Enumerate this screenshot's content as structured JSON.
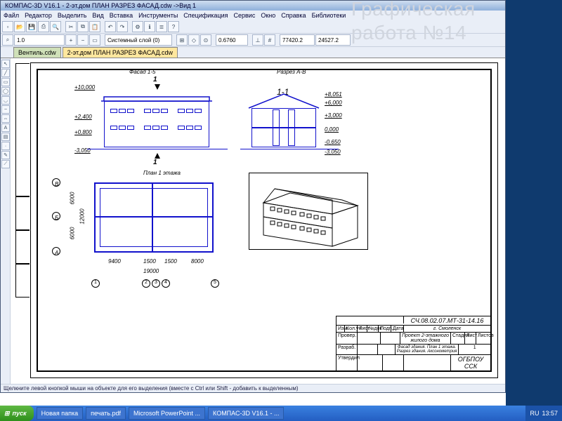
{
  "slide_title": "Графическая\nработа №14",
  "app": {
    "title": "КОМПАС-3D V16.1 - 2-эт.дом ПЛАН РАЗРЕЗ ФАСАД.cdw ->Вид 1",
    "menu": [
      "Файл",
      "Редактор",
      "Выделить",
      "Вид",
      "Вставка",
      "Инструменты",
      "Спецификация",
      "Сервис",
      "Окно",
      "Справка",
      "Библиотеки"
    ],
    "zoom": "1.0",
    "layer_combo": "Системный слой (0)",
    "coord1": "0.6760",
    "coord2": "77420.2",
    "coord3": "24527.2",
    "tabs": [
      {
        "label": "Вентиль.cdw",
        "active": false
      },
      {
        "label": "2-эт.дом ПЛАН РАЗРЕЗ ФАСАД.cdw",
        "active": true
      }
    ],
    "status": "Щелкните левой кнопкой мыши на объекте для его выделения (вместе с Ctrl или Shift - добавить к выделенным)"
  },
  "drawing": {
    "facade_title": "Фасад 1-5",
    "section_title": "Разрез А-В",
    "section_mark": "1-1",
    "section_mark2": "1",
    "plan_title": "План 1 этажа",
    "facade_levels": [
      "+10,000",
      "+2,400",
      "+0,800",
      "-3,050"
    ],
    "section_levels": [
      "+8,051",
      "+6,000",
      "+3,000",
      "0,000",
      "-0,650",
      "-3,050"
    ],
    "plan_dims": {
      "w1": "9400",
      "w2": "1500",
      "w3": "1500",
      "w4": "8000",
      "total": "19000",
      "h1": "6000",
      "h2": "6000",
      "h3": "12000"
    },
    "grid_letters": [
      "A",
      "Б",
      "В"
    ],
    "grid_numbers": [
      "1",
      "2",
      "3",
      "4",
      "5"
    ],
    "titleblock": {
      "code": "СЧ.08.02.07.МТ-31-14.16",
      "city": "г. Смоленск",
      "project": "Проект 2-этажного\nжилого дома",
      "line3": "Фасад здания. План 1 этажа.\nРазрез здания. Аксонометрия",
      "org": "ОГБПОУ ССК",
      "stage": "Стадия",
      "sheet": "Лист",
      "sheets": "Листов",
      "sheet_no": "1",
      "hdr": [
        "Изм.",
        "Кол.уч",
        "Лист",
        "№док",
        "Подп.",
        "Дата"
      ],
      "roles": [
        "Провер.",
        "Разраб.",
        "Утвердил"
      ]
    }
  },
  "taskbar": {
    "start": "пуск",
    "items": [
      "Новая папка",
      "печать.pdf",
      "Microsoft PowerPoint ...",
      "КОМПАС-3D V16.1 - ..."
    ],
    "lang": "RU",
    "time": "13:57"
  }
}
